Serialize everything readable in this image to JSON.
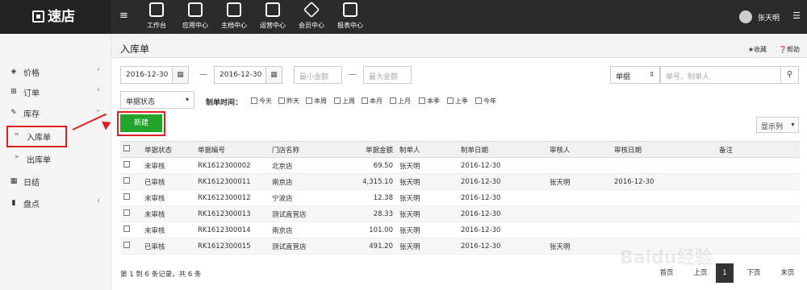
{
  "app": {
    "logo_text": "速店"
  },
  "topnav": [
    {
      "label": "工作台",
      "icon": "monitor-icon"
    },
    {
      "label": "应用中心",
      "icon": "bag-icon"
    },
    {
      "label": "主档中心",
      "icon": "document-icon"
    },
    {
      "label": "运营中心",
      "icon": "flag-icon"
    },
    {
      "label": "会员中心",
      "icon": "diamond-icon"
    },
    {
      "label": "报表中心",
      "icon": "chart-icon"
    }
  ],
  "user": {
    "name": "张天明"
  },
  "sidebar": {
    "items": [
      {
        "label": "价格",
        "icon": "layers-icon"
      },
      {
        "label": "订单",
        "icon": "cart-icon"
      },
      {
        "label": "库存",
        "icon": "wrench-icon"
      },
      {
        "label": "入库单"
      },
      {
        "label": "出库单"
      },
      {
        "label": "日结",
        "icon": "calendar-icon"
      },
      {
        "label": "盘点",
        "icon": "bar-chart-icon"
      }
    ]
  },
  "page": {
    "title": "入库单",
    "favorite": "收藏",
    "help": "帮助"
  },
  "filters": {
    "date_from": "2016-12-30",
    "date_to": "2016-12-30",
    "min_amount_placeholder": "最小金额",
    "max_amount_placeholder": "最大金额",
    "search_type": "单据",
    "search_placeholder": "单号、制单人",
    "status_select": "单据状态",
    "time_label": "制单时间：",
    "time_options": [
      "今天",
      "昨天",
      "本周",
      "上周",
      "本月",
      "上月",
      "本季",
      "上季",
      "今年"
    ]
  },
  "toolbar": {
    "new_label": "新建",
    "columns_label": "显示列"
  },
  "table": {
    "headers": [
      "单据状态",
      "单据编号",
      "门店名称",
      "单据金额",
      "制单人",
      "制单日期",
      "审核人",
      "审核日期",
      "备注"
    ],
    "rows": [
      [
        "未审核",
        "RK1612300002",
        "北京店",
        "69.50",
        "张天明",
        "2016-12-30",
        "",
        "",
        ""
      ],
      [
        "已审核",
        "RK1612300011",
        "南京店",
        "4,315.10",
        "张天明",
        "2016-12-30",
        "张天明",
        "2016-12-30",
        ""
      ],
      [
        "未审核",
        "RK1612300012",
        "宁波店",
        "12.38",
        "张天明",
        "2016-12-30",
        "",
        "",
        ""
      ],
      [
        "未审核",
        "RK1612300013",
        "测试直营店",
        "28.33",
        "张天明",
        "2016-12-30",
        "",
        "",
        ""
      ],
      [
        "未审核",
        "RK1612300014",
        "南京店",
        "101.00",
        "张天明",
        "2016-12-30",
        "",
        "",
        ""
      ],
      [
        "已审核",
        "RK1612300015",
        "测试直营店",
        "491.20",
        "张天明",
        "2016-12-30",
        "张天明",
        "",
        ""
      ]
    ]
  },
  "pagination": {
    "summary": "第 1 到 6 条记录，共 6 条",
    "first": "首页",
    "prev": "上页",
    "current": "1",
    "next": "下页",
    "last": "末页"
  },
  "watermark": "Baidu经验"
}
